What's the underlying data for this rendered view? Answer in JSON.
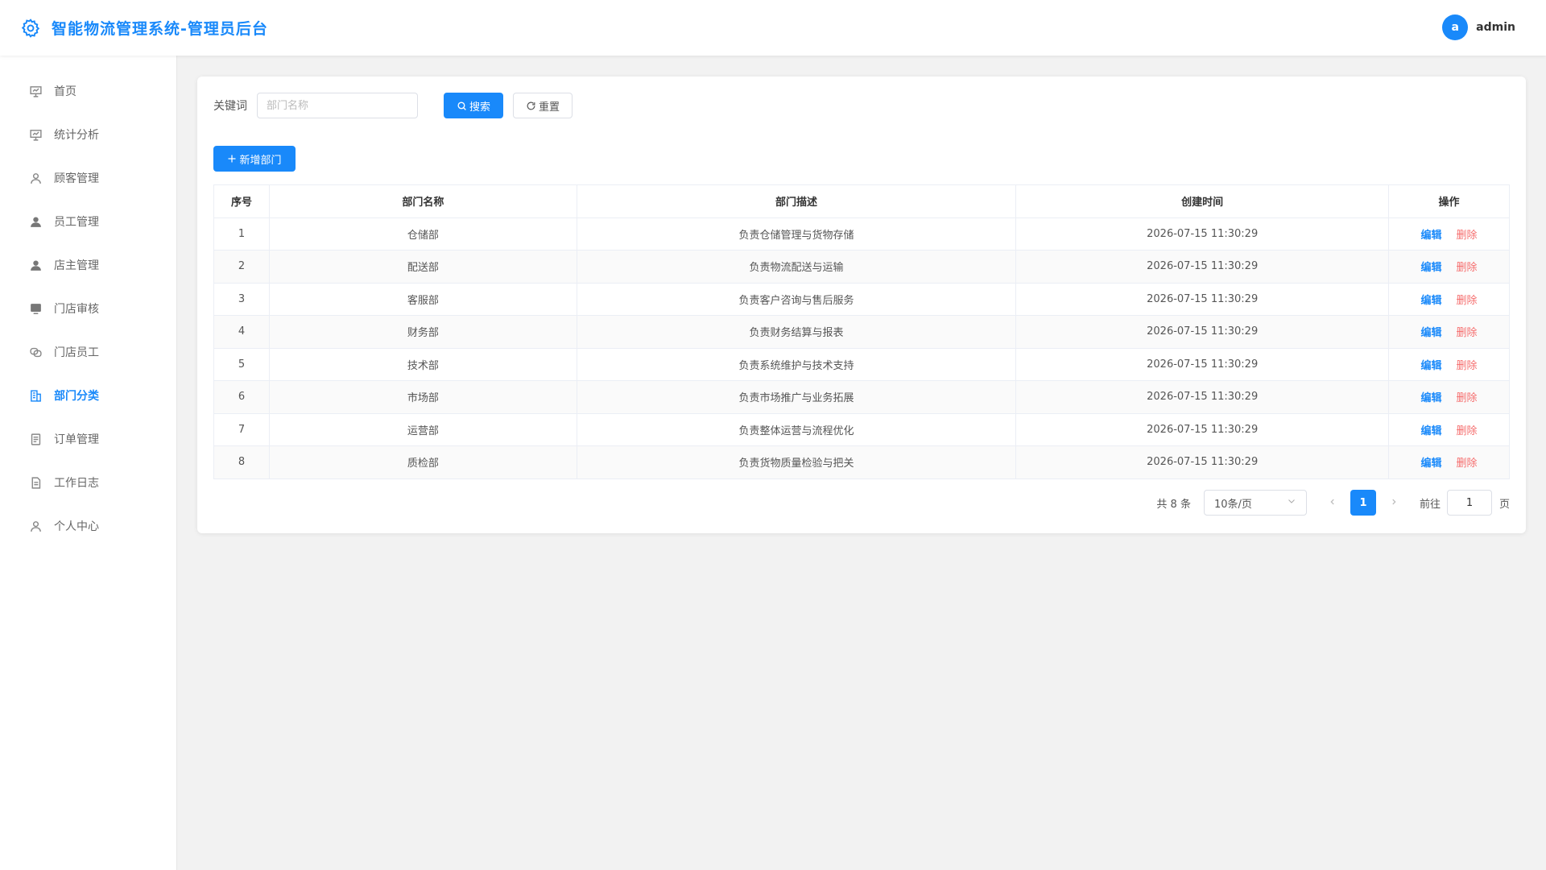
{
  "header": {
    "title": "智能物流管理系统-管理员后台",
    "avatar_letter": "a",
    "username": "admin"
  },
  "sidebar": {
    "items": [
      {
        "label": "首页",
        "icon": "presentation-icon",
        "active": false
      },
      {
        "label": "统计分析",
        "icon": "presentation-icon",
        "active": false
      },
      {
        "label": "顾客管理",
        "icon": "user-outline-icon",
        "active": false
      },
      {
        "label": "员工管理",
        "icon": "user-filled-icon",
        "active": false
      },
      {
        "label": "店主管理",
        "icon": "user-filled-icon",
        "active": false
      },
      {
        "label": "门店审核",
        "icon": "monitor-icon",
        "active": false
      },
      {
        "label": "门店员工",
        "icon": "link-icon",
        "active": false
      },
      {
        "label": "部门分类",
        "icon": "building-icon",
        "active": true
      },
      {
        "label": "订单管理",
        "icon": "document-icon",
        "active": false
      },
      {
        "label": "工作日志",
        "icon": "document-icon",
        "active": false
      },
      {
        "label": "个人中心",
        "icon": "user-outline-icon",
        "active": false
      }
    ]
  },
  "search": {
    "label": "关键词",
    "placeholder": "部门名称",
    "value": "",
    "search_label": "搜索",
    "reset_label": "重置"
  },
  "add_button_label": "新增部门",
  "table": {
    "columns": [
      "序号",
      "部门名称",
      "部门描述",
      "创建时间",
      "操作"
    ],
    "edit_label": "编辑",
    "delete_label": "删除",
    "rows": [
      {
        "index": "1",
        "name": "仓储部",
        "desc": "负责仓储管理与货物存储",
        "created": "2026-07-15 11:30:29"
      },
      {
        "index": "2",
        "name": "配送部",
        "desc": "负责物流配送与运输",
        "created": "2026-07-15 11:30:29"
      },
      {
        "index": "3",
        "name": "客服部",
        "desc": "负责客户咨询与售后服务",
        "created": "2026-07-15 11:30:29"
      },
      {
        "index": "4",
        "name": "财务部",
        "desc": "负责财务结算与报表",
        "created": "2026-07-15 11:30:29"
      },
      {
        "index": "5",
        "name": "技术部",
        "desc": "负责系统维护与技术支持",
        "created": "2026-07-15 11:30:29"
      },
      {
        "index": "6",
        "name": "市场部",
        "desc": "负责市场推广与业务拓展",
        "created": "2026-07-15 11:30:29"
      },
      {
        "index": "7",
        "name": "运营部",
        "desc": "负责整体运营与流程优化",
        "created": "2026-07-15 11:30:29"
      },
      {
        "index": "8",
        "name": "质检部",
        "desc": "负责货物质量检验与把关",
        "created": "2026-07-15 11:30:29"
      }
    ]
  },
  "pagination": {
    "total_text": "共 8 条",
    "page_size": "10条/页",
    "current_page": "1",
    "goto_label": "前往",
    "goto_value": "1",
    "goto_suffix": "页"
  },
  "colors": {
    "accent": "#1989fa",
    "danger": "#f56c6c",
    "background": "#f2f2f2"
  }
}
